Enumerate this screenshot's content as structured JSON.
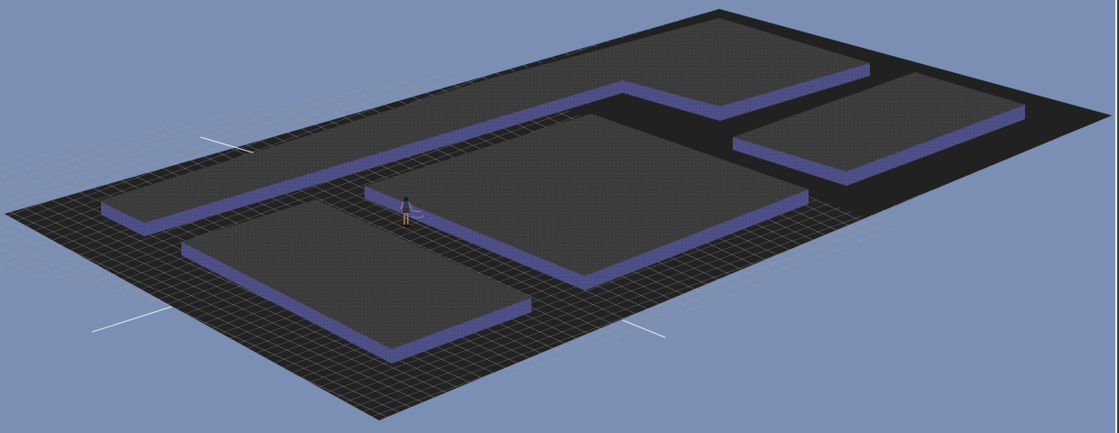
{
  "viewport": {
    "kind": "3d-perspective-view",
    "background_color": "#7b8eb4",
    "floor_color": "#232323",
    "grid_line_color": "#a9a9a9",
    "ghost_grid_color": "#b8a48a",
    "axis_color": "#e6ebf5",
    "platform_top_color": "#3d3d3d",
    "platform_side_color": "#4e4f86",
    "platform_count": 5,
    "character": "standing-avatar"
  }
}
